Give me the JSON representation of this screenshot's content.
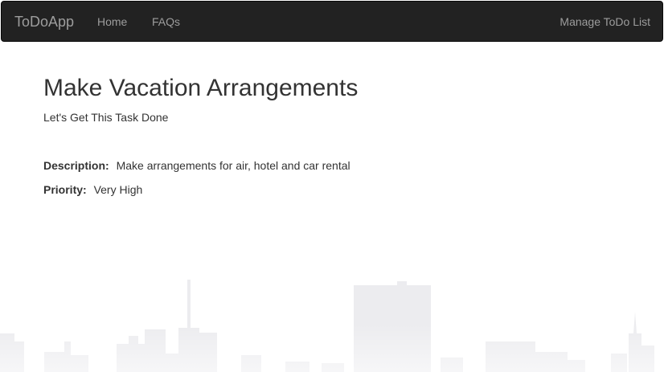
{
  "navbar": {
    "brand": "ToDoApp",
    "links": [
      {
        "label": "Home"
      },
      {
        "label": "FAQs"
      }
    ],
    "right_link": "Manage ToDo List"
  },
  "task": {
    "title": "Make Vacation Arrangements",
    "subtitle": "Let's Get This Task Done",
    "description_label": "Description:",
    "description_value": "Make arrangements for air, hotel and car rental",
    "priority_label": "Priority:",
    "priority_value": "Very High"
  },
  "colors": {
    "navbar_bg": "#222222",
    "nav_text": "#9d9d9d",
    "body_text": "#333333",
    "skyline": "#ebebee"
  }
}
